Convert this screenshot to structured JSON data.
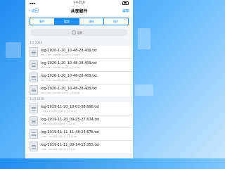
{
  "status_bar": {
    "time": "下午2:19"
  },
  "nav": {
    "back_label": "返回",
    "title": "共享郵件",
    "edit_label": "編輯"
  },
  "tabs": [
    {
      "label": "郵件",
      "active": false
    },
    {
      "label": "檔案",
      "active": true
    },
    {
      "label": "連結",
      "active": false
    },
    {
      "label": "相片",
      "active": false
    }
  ],
  "search": {
    "placeholder": "搜尋"
  },
  "sections": [
    {
      "header": "1月 2020",
      "files": [
        {
          "name": "log-2020-1-20_10-48-28.409.txt",
          "meta": "581.7 KB • 2020年1月20日 上午10:48"
        },
        {
          "name": "log-2020-1-20_10-48-28.409.txt",
          "meta": "581.7 KB • 2020年1月20日 上午10:48"
        },
        {
          "name": "log-2020-1-20_10-48-28.409.txt",
          "meta": "581.7 KB • 2020年1月20日 上午10:48"
        },
        {
          "name": "log-2020-1-20_10-48-28.409.txt",
          "meta": "581.7 KB • 2020年1月20日 上午10:48"
        }
      ]
    },
    {
      "header": "11月 2019",
      "files": [
        {
          "name": "log-2019-11-20_10-01-58.698.txt",
          "meta": "1 MB • 2019年11月20日 上午10:01"
        },
        {
          "name": "log-2019-11-20_09-25-27.674.txt",
          "meta": "1 MB • 2019年11月20日 上午9:25"
        },
        {
          "name": "log-2019-11-11_11-48-24.676.txt",
          "meta": "1 MB • 2019年11月11日 上午11:48"
        },
        {
          "name": "log-2019-11-11_09-14-15.353.txt",
          "meta": "1 MB • 2019年11月11日 上午9:14"
        }
      ]
    }
  ]
}
